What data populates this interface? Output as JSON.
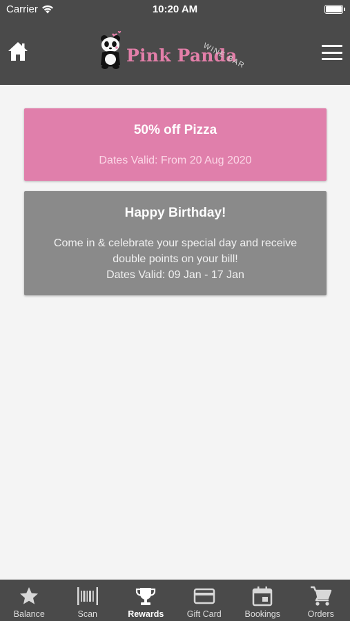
{
  "status_bar": {
    "carrier": "Carrier",
    "time": "10:20 AM"
  },
  "header": {
    "logo_text": "Pink Panda",
    "logo_tagline": "WINE BAR",
    "home_icon": "home-icon",
    "menu_icon": "hamburger-menu-icon"
  },
  "rewards": [
    {
      "title": "50% off Pizza",
      "dates": "Dates Valid: From 20 Aug 2020"
    },
    {
      "title": "Happy Birthday!",
      "description": "Come in & celebrate your special day and receive double points on your bill!",
      "dates": "Dates Valid: 09 Jan - 17 Jan"
    }
  ],
  "tabs": [
    {
      "label": "Balance",
      "icon": "star-icon"
    },
    {
      "label": "Scan",
      "icon": "barcode-icon"
    },
    {
      "label": "Rewards",
      "icon": "trophy-icon",
      "active": true
    },
    {
      "label": "Gift Card",
      "icon": "credit-card-icon"
    },
    {
      "label": "Bookings",
      "icon": "calendar-icon"
    },
    {
      "label": "Orders",
      "icon": "cart-icon"
    }
  ],
  "colors": {
    "bar": "#4a4a4a",
    "pink_card": "#e07fab",
    "grey_card": "#8a8a8a",
    "background": "#f4f4f4",
    "brand_pink": "#e37fa9"
  }
}
